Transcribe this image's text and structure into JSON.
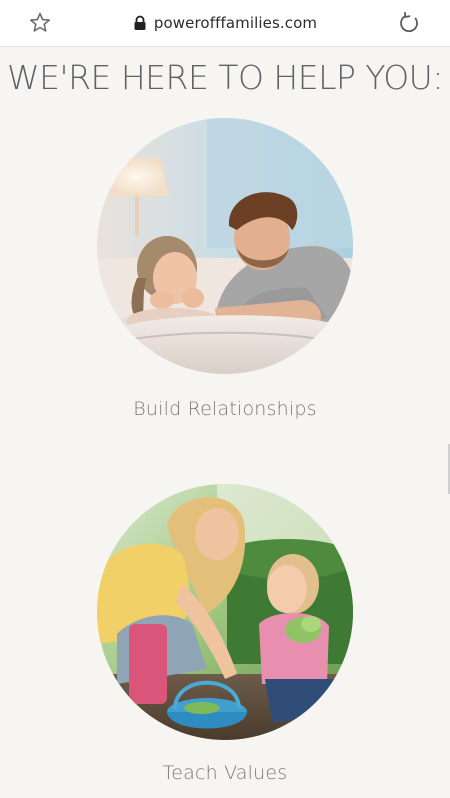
{
  "browser": {
    "url": "powerofffamilies.com",
    "star_icon": "star-outline-icon",
    "lock_icon": "lock-icon",
    "reload_icon": "reload-icon"
  },
  "page": {
    "headline": "WE'RE HERE TO HELP YOU:",
    "sections": [
      {
        "caption": "Build Relationships",
        "image": "father-and-daughter-on-bed-photo"
      },
      {
        "caption": "Teach Values",
        "image": "mother-and-daughter-gardening-photo"
      }
    ]
  },
  "colors": {
    "page_bg": "#f6f5f1",
    "headline_text": "#5f6266",
    "caption_text": "#7a7a7a"
  }
}
